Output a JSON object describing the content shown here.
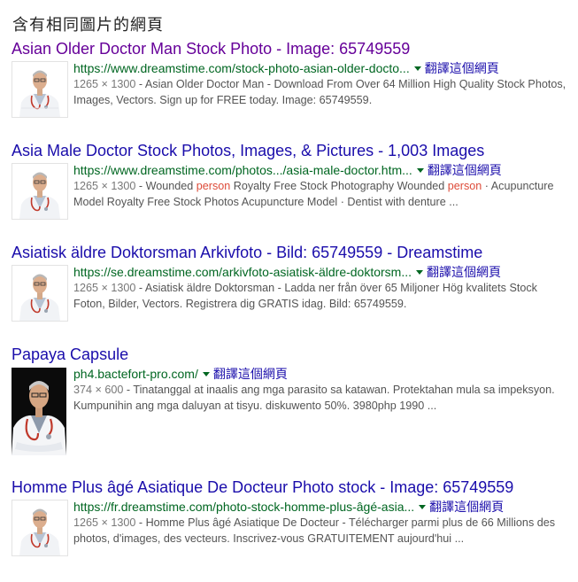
{
  "heading": "含有相同圖片的網頁",
  "translate_label": "翻譯這個網頁",
  "colors": {
    "title_link": "#1a0dab",
    "title_visited": "#660099",
    "url_green": "#006621",
    "snippet_gray": "#545454",
    "highlight_red": "#dd4b39"
  },
  "results": [
    {
      "title": "Asian Older Doctor Man Stock Photo - Image: 65749559",
      "url": "https://www.dreamstime.com/stock-photo-asian-older-docto...",
      "dims": "1265 × 1300",
      "snippet_a": " - Asian Older Doctor Man - Download From Over 64 Million High Quality Stock Photos, Images, Vectors. Sign up for FREE today. Image: 65749559.",
      "thumb": "doctor-thumbnail"
    },
    {
      "title": "Asia Male Doctor Stock Photos, Images, & Pictures - 1,003 Images",
      "url": "https://www.dreamstime.com/photos.../asia-male-doctor.htm...",
      "dims": "1265 × 1300",
      "snippet_a": " - Wounded ",
      "hl_1": "person",
      "snippet_b": " Royalty Free Stock Photography Wounded ",
      "hl_2": "person",
      "snippet_c": " · Acupuncture Model Royalty Free Stock Photos Acupuncture Model · Dentist with denture ...",
      "thumb": "doctor-thumbnail"
    },
    {
      "title": "Asiatisk äldre Doktorsman Arkivfoto - Bild: 65749559 - Dreamstime",
      "url": "https://se.dreamstime.com/arkivfoto-asiatisk-äldre-doktorsm...",
      "dims": "1265 × 1300",
      "snippet_a": " - Asiatisk äldre Doktorsman - Ladda ner från över 65 Miljoner Hög kvalitets Stock Foton, Bilder, Vectors. Registrera dig GRATIS idag. Bild: 65749559.",
      "thumb": "doctor-thumbnail"
    },
    {
      "title": "Papaya Capsule",
      "url": "ph4.bactefort-pro.com/",
      "dims": "374 × 600",
      "snippet_a": " - Tinatanggal at inaalis ang mga parasito sa katawan. Protektahan mula sa impeksyon. Kumpunihin ang mga daluyan at tisyu. diskuwento 50%. 3980php 1990 ...",
      "thumb": "doctor-portrait-dark-thumbnail"
    },
    {
      "title": "Homme Plus âgé Asiatique De Docteur Photo stock - Image: 65749559",
      "url": "https://fr.dreamstime.com/photo-stock-homme-plus-âgé-asia...",
      "dims": "1265 × 1300",
      "snippet_a": " - Homme Plus âgé Asiatique De Docteur - Télécharger parmi plus de 66 Millions des photos, d'images, des vecteurs. Inscrivez-vous GRATUITEMENT aujourd'hui ...",
      "thumb": "doctor-thumbnail"
    }
  ]
}
